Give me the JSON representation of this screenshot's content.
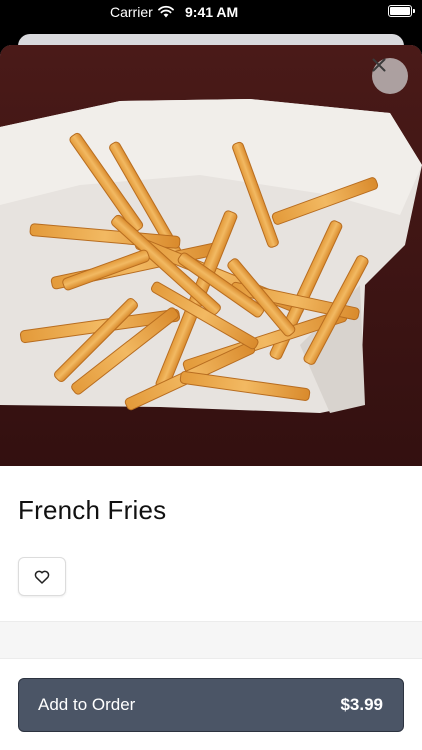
{
  "status_bar": {
    "carrier": "Carrier",
    "time": "9:41 AM"
  },
  "item": {
    "name": "French Fries",
    "image_icon": "french-fries-photo"
  },
  "actions": {
    "close_icon": "close-icon",
    "favorite_icon": "heart-icon",
    "add_label": "Add to Order",
    "price": "$3.99"
  },
  "colors": {
    "button": "#4b5566",
    "hero_background": "#3a1414"
  }
}
